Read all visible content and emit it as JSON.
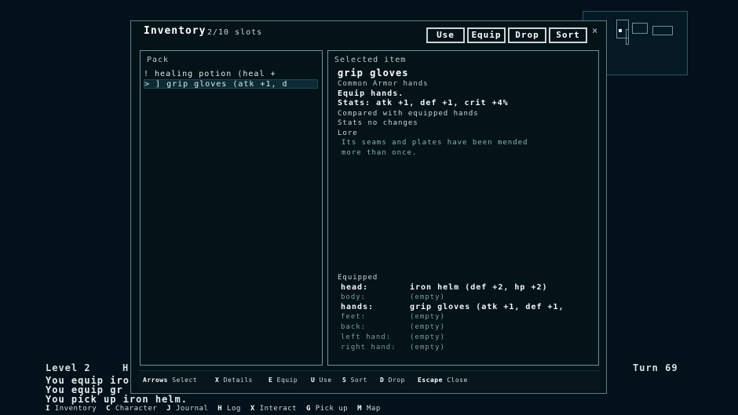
{
  "hud": {
    "level": "Level 2",
    "hp_initial": "H",
    "turn": "Turn 69"
  },
  "log": [
    "You equip iro",
    "You equip gr",
    "You pick up iron helm."
  ],
  "hotkeys": [
    {
      "key": "I",
      "label": "Inventory"
    },
    {
      "key": "C",
      "label": "Character"
    },
    {
      "key": "J",
      "label": "Journal"
    },
    {
      "key": "H",
      "label": "Log"
    },
    {
      "key": "X",
      "label": "Interact"
    },
    {
      "key": "G",
      "label": "Pick up"
    },
    {
      "key": "M",
      "label": "Map"
    }
  ],
  "modal": {
    "title": "Inventory",
    "slots": "2/10 slots",
    "buttons": {
      "use": "Use",
      "equip": "Equip",
      "drop": "Drop",
      "sort": "Sort"
    },
    "close": "×",
    "pack": {
      "label": "Pack",
      "items": [
        {
          "text": "  ! healing potion (heal +"
        },
        {
          "text": "> ] grip gloves (atk +1, d"
        }
      ]
    },
    "selected": {
      "label": "Selected item",
      "name": "grip gloves",
      "meta": "Common   Armor   hands",
      "desc": "Equip hands.",
      "stats": "Stats: atk +1, def +1, crit +4%",
      "compare_label": "Compared with equipped hands",
      "compare_value": " Stats no changes",
      "lore_label": "Lore",
      "lore_lines": [
        "Its seams and plates have been mended",
        "more than once."
      ]
    },
    "equipped": {
      "label": "Equipped",
      "rows": [
        {
          "slot": "head:",
          "value": "iron helm (def +2, hp +2)"
        },
        {
          "slot": "body:",
          "value": "(empty)"
        },
        {
          "slot": "hands:",
          "value": "grip gloves (atk +1, def +1,"
        },
        {
          "slot": "feet:",
          "value": "(empty)"
        },
        {
          "slot": "back:",
          "value": "(empty)"
        },
        {
          "slot": "left hand:",
          "value": "(empty)"
        },
        {
          "slot": "right hand:",
          "value": "(empty)"
        }
      ]
    },
    "footer": [
      {
        "key": "Arrows",
        "label": "Select"
      },
      {
        "key": "X",
        "label": "Details"
      },
      {
        "key": "E",
        "label": "Equip"
      },
      {
        "key": "U",
        "label": "Use"
      },
      {
        "key": "S",
        "label": "Sort"
      },
      {
        "key": "D",
        "label": "Drop"
      },
      {
        "key": "Escape",
        "label": "Close"
      }
    ]
  },
  "colors": {
    "background": "#03111a",
    "modal_border": "#5b7f88",
    "text": "#d8e2e2"
  }
}
